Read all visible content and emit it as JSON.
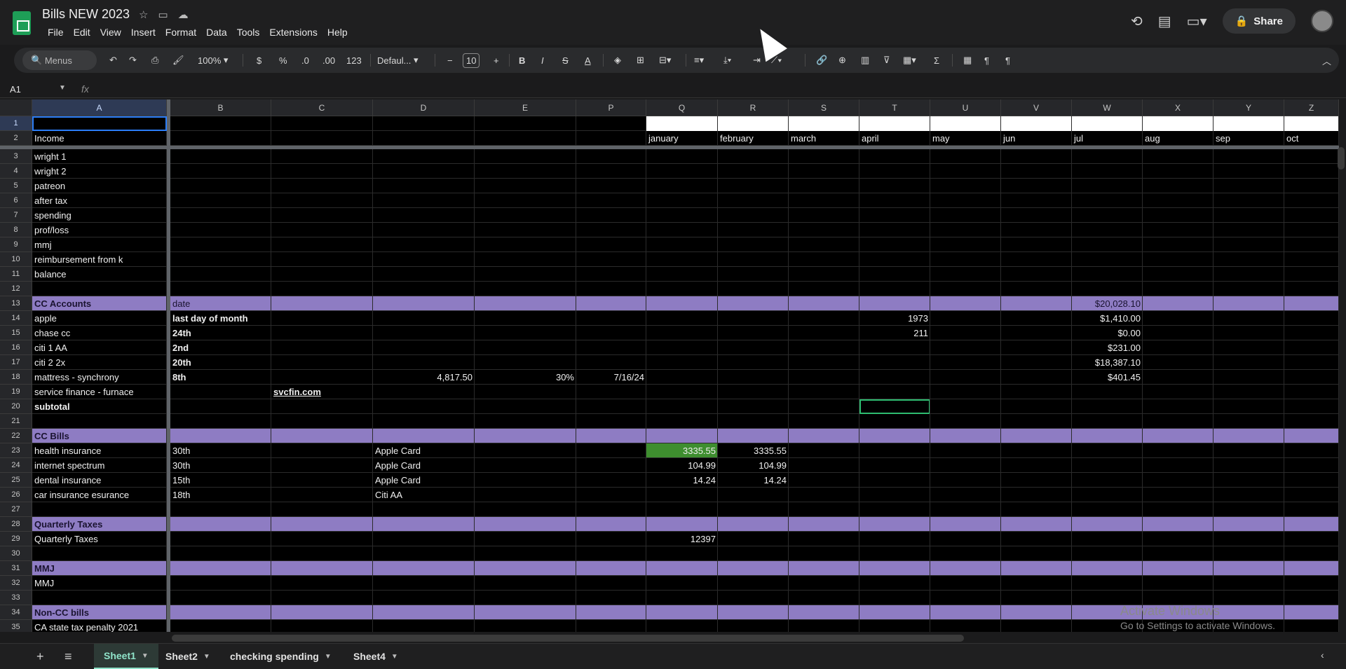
{
  "app": {
    "title": "Bills NEW 2023",
    "menu": [
      "File",
      "Edit",
      "View",
      "Insert",
      "Format",
      "Data",
      "Tools",
      "Extensions",
      "Help"
    ],
    "share_label": "Share"
  },
  "toolbar": {
    "search_label": "Menus",
    "zoom": "100%",
    "currency": "$",
    "percent": "%",
    "dec_less": ".0",
    "dec_more": ".00",
    "number_format": "123",
    "font": "Defaul...",
    "font_size": "10"
  },
  "formula_bar": {
    "name_box": "A1",
    "fx": "fx",
    "value": ""
  },
  "columns": [
    "A",
    "B",
    "C",
    "D",
    "E",
    "P",
    "Q",
    "R",
    "S",
    "T",
    "U",
    "V",
    "W",
    "X",
    "Y",
    "Z"
  ],
  "rows": {
    "r2": {
      "A": "Income",
      "months": [
        "january",
        "february",
        "march",
        "april",
        "may",
        "jun",
        "jul",
        "aug",
        "sep",
        "oct"
      ]
    },
    "r3": {
      "A": "wright 1"
    },
    "r4": {
      "A": "wright 2"
    },
    "r5": {
      "A": "patreon"
    },
    "r6": {
      "A": "after tax"
    },
    "r7": {
      "A": "spending"
    },
    "r8": {
      "A": "prof/loss"
    },
    "r9": {
      "A": "mmj"
    },
    "r10": {
      "A": "reimbursement from k"
    },
    "r11": {
      "A": "balance"
    },
    "r13": {
      "A": "CC Accounts",
      "B": "date",
      "W": "$20,028.10"
    },
    "r14": {
      "A": "apple",
      "B": "last day of month",
      "T": "1973",
      "W": "$1,410.00"
    },
    "r15": {
      "A": "chase cc",
      "B": "24th",
      "T": "211",
      "W": "$0.00"
    },
    "r16": {
      "A": "citi 1 AA",
      "B": "2nd",
      "W": "$231.00"
    },
    "r17": {
      "A": "citi 2 2x",
      "B": "20th",
      "W": "$18,387.10"
    },
    "r18": {
      "A": "mattress - synchrony",
      "B": "8th",
      "D": "4,817.50",
      "E": "30%",
      "P": "7/16/24",
      "W": "$401.45"
    },
    "r19": {
      "A": "service finance - furnace",
      "C": "svcfin.com"
    },
    "r20": {
      "A": "subtotal"
    },
    "r22": {
      "A": "CC Bills"
    },
    "r23": {
      "A": "health insurance",
      "B": "30th",
      "D": "Apple Card",
      "Q": "3335.55",
      "R": "3335.55"
    },
    "r24": {
      "A": "internet spectrum",
      "B": "30th",
      "D": "Apple Card",
      "Q": "104.99",
      "R": "104.99"
    },
    "r25": {
      "A": "dental insurance",
      "B": "15th",
      "D": "Apple Card",
      "Q": "14.24",
      "R": "14.24"
    },
    "r26": {
      "A": "car insurance esurance",
      "B": "18th",
      "D": "Citi AA"
    },
    "r28": {
      "A": "Quarterly Taxes"
    },
    "r29": {
      "A": "Quarterly Taxes",
      "Q": "12397"
    },
    "r31": {
      "A": "MMJ"
    },
    "r32": {
      "A": "MMJ"
    },
    "r34": {
      "A": "Non-CC bills"
    },
    "r35": {
      "A": "CA state tax penalty 2021"
    }
  },
  "sheets": [
    "Sheet1",
    "Sheet2",
    "checking spending",
    "Sheet4"
  ],
  "watermark": {
    "line1": "Activate Windows",
    "line2": "Go to Settings to activate Windows."
  },
  "colors": {
    "band": "#8e7cc3",
    "selection": "#2b7df7",
    "green": "#3e8e2f"
  }
}
